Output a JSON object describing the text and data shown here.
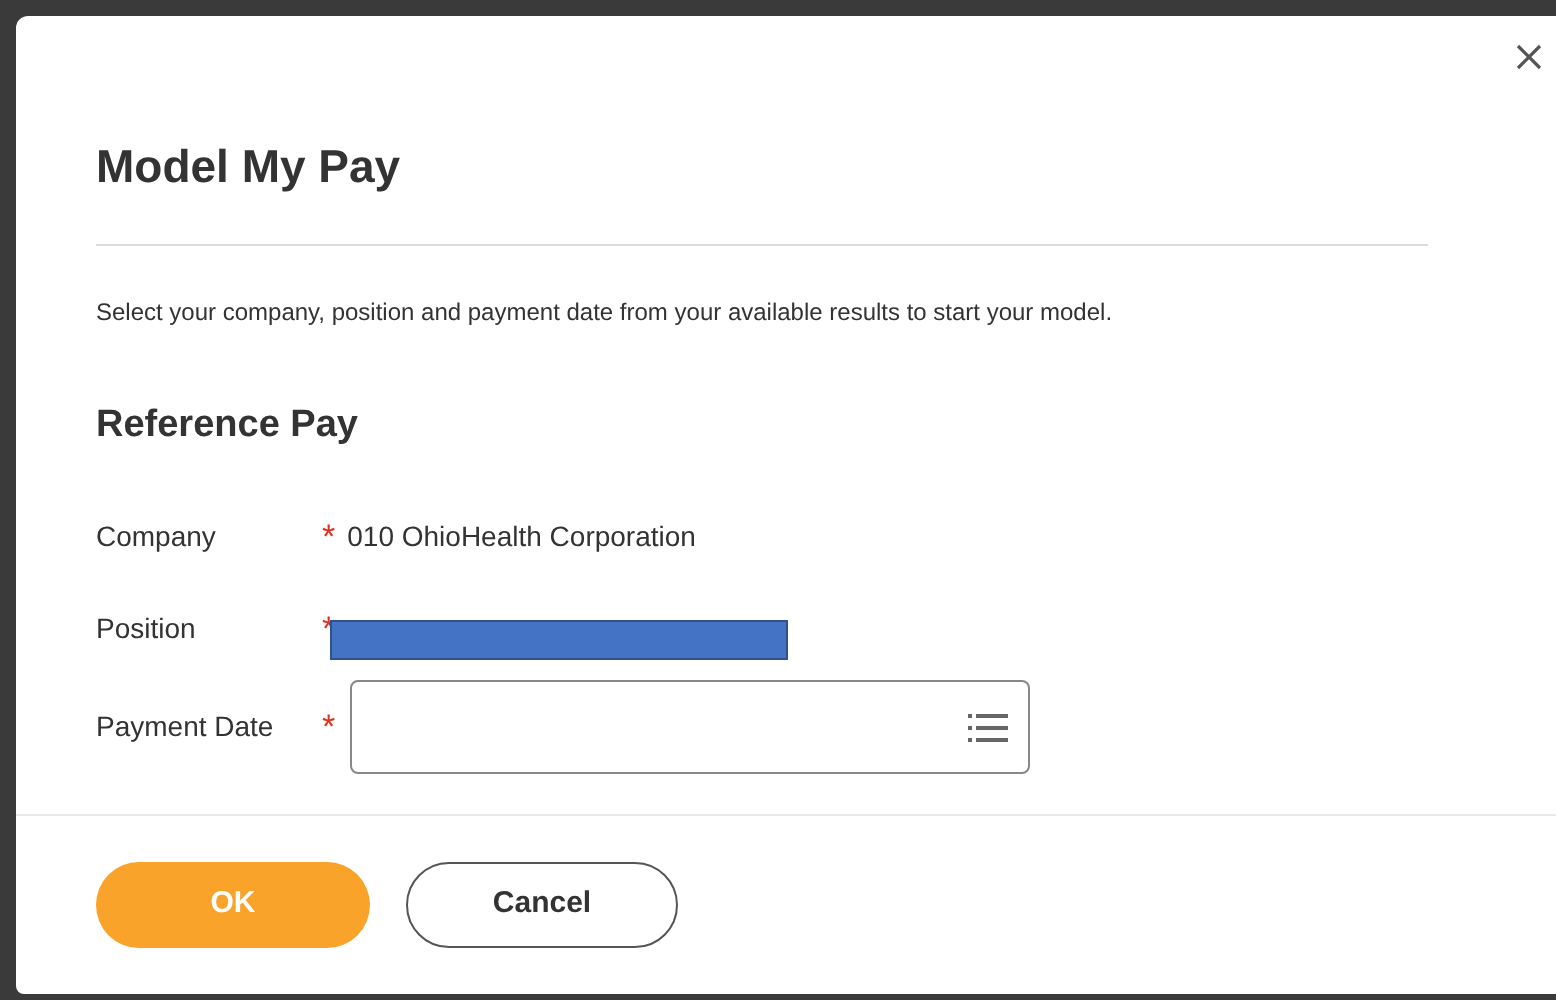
{
  "dialog": {
    "title": "Model My Pay",
    "description": "Select your company, position and payment date from your available results to start your model.",
    "section": "Reference Pay",
    "fields": [
      {
        "kind": "text",
        "label": "Company",
        "required_mark": "*",
        "value": "010 OhioHealth Corporation"
      },
      {
        "kind": "redacted",
        "label": "Position",
        "required_mark": "*"
      },
      {
        "kind": "date",
        "label": "Payment Date",
        "required_mark": "*"
      }
    ],
    "buttons": [
      {
        "kind": "primary",
        "label": "OK"
      },
      {
        "kind": "secondary",
        "label": "Cancel"
      }
    ]
  }
}
